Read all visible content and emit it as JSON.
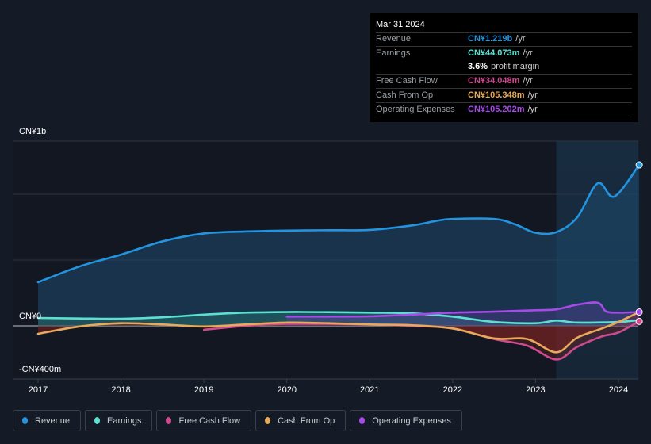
{
  "tooltip": {
    "date": "Mar 31 2024",
    "rows": [
      {
        "label": "Revenue",
        "value": "CN¥1.219b",
        "unit": "/yr",
        "color": "#2394df"
      },
      {
        "label": "Earnings",
        "value": "CN¥44.073m",
        "unit": "/yr",
        "color": "#5ce0cf"
      },
      {
        "label": "",
        "value": "3.6%",
        "unit": "profit margin",
        "color": "#ffffff"
      },
      {
        "label": "Free Cash Flow",
        "value": "CN¥34.048m",
        "unit": "/yr",
        "color": "#d04a8f"
      },
      {
        "label": "Cash From Op",
        "value": "CN¥105.348m",
        "unit": "/yr",
        "color": "#e8a95b"
      },
      {
        "label": "Operating Expenses",
        "value": "CN¥105.202m",
        "unit": "/yr",
        "color": "#a64be8"
      }
    ]
  },
  "legend": [
    {
      "label": "Revenue",
      "color": "#2394df"
    },
    {
      "label": "Earnings",
      "color": "#5ce0cf"
    },
    {
      "label": "Free Cash Flow",
      "color": "#d04a8f"
    },
    {
      "label": "Cash From Op",
      "color": "#e8a95b"
    },
    {
      "label": "Operating Expenses",
      "color": "#a64be8"
    }
  ],
  "chart_data": {
    "type": "line",
    "title": "",
    "xlabel": "",
    "ylabel": "",
    "y_tick_labels": [
      "CN¥1b",
      "CN¥0",
      "-CN¥400m"
    ],
    "x_tick_labels": [
      "2017",
      "2018",
      "2019",
      "2020",
      "2021",
      "2022",
      "2023",
      "2024"
    ],
    "xlim": [
      2016.7,
      2024.25
    ],
    "ylim": [
      -400,
      1400
    ],
    "unit": "CN¥m",
    "highlight_from": 2023.25,
    "series": [
      {
        "name": "Revenue",
        "color": "#2394df",
        "x": [
          2017.0,
          2017.5,
          2018.0,
          2018.5,
          2019.0,
          2019.5,
          2020.0,
          2020.5,
          2021.0,
          2021.5,
          2021.8,
          2022.0,
          2022.5,
          2022.75,
          2023.0,
          2023.25,
          2023.5,
          2023.75,
          2023.95,
          2024.25
        ],
        "y": [
          330,
          450,
          540,
          640,
          700,
          715,
          722,
          725,
          727,
          760,
          795,
          810,
          810,
          770,
          705,
          710,
          820,
          1080,
          980,
          1219
        ]
      },
      {
        "name": "Earnings",
        "color": "#5ce0cf",
        "x": [
          2017.0,
          2017.5,
          2018.0,
          2018.5,
          2019.0,
          2019.5,
          2020.0,
          2020.5,
          2021.0,
          2021.5,
          2022.0,
          2022.5,
          2023.0,
          2023.25,
          2023.5,
          2024.0,
          2024.25
        ],
        "y": [
          60,
          56,
          54,
          65,
          85,
          100,
          105,
          104,
          100,
          95,
          70,
          30,
          20,
          40,
          25,
          30,
          44
        ]
      },
      {
        "name": "Free Cash Flow",
        "color": "#d04a8f",
        "x": [
          2019.0,
          2019.5,
          2020.0,
          2020.5,
          2021.0,
          2021.5,
          2022.0,
          2022.5,
          2022.9,
          2023.25,
          2023.5,
          2023.8,
          2024.0,
          2024.25
        ],
        "y": [
          -30,
          0,
          15,
          15,
          10,
          0,
          -20,
          -100,
          -150,
          -255,
          -160,
          -80,
          -50,
          34
        ]
      },
      {
        "name": "Cash From Op",
        "color": "#e8a95b",
        "x": [
          2017.0,
          2017.5,
          2018.0,
          2018.5,
          2019.0,
          2019.5,
          2020.0,
          2020.5,
          2021.0,
          2021.5,
          2022.0,
          2022.5,
          2022.9,
          2023.25,
          2023.5,
          2023.8,
          2024.0,
          2024.25
        ],
        "y": [
          -60,
          -5,
          20,
          10,
          -5,
          10,
          25,
          20,
          10,
          5,
          -20,
          -95,
          -100,
          -200,
          -90,
          -20,
          30,
          105
        ]
      },
      {
        "name": "Operating Expenses",
        "color": "#a64be8",
        "x": [
          2020.0,
          2020.5,
          2021.0,
          2021.5,
          2022.0,
          2022.5,
          2023.0,
          2023.25,
          2023.5,
          2023.75,
          2023.85,
          2024.0,
          2024.25
        ],
        "y": [
          70,
          70,
          72,
          85,
          100,
          108,
          118,
          125,
          160,
          175,
          110,
          100,
          105
        ]
      }
    ]
  }
}
